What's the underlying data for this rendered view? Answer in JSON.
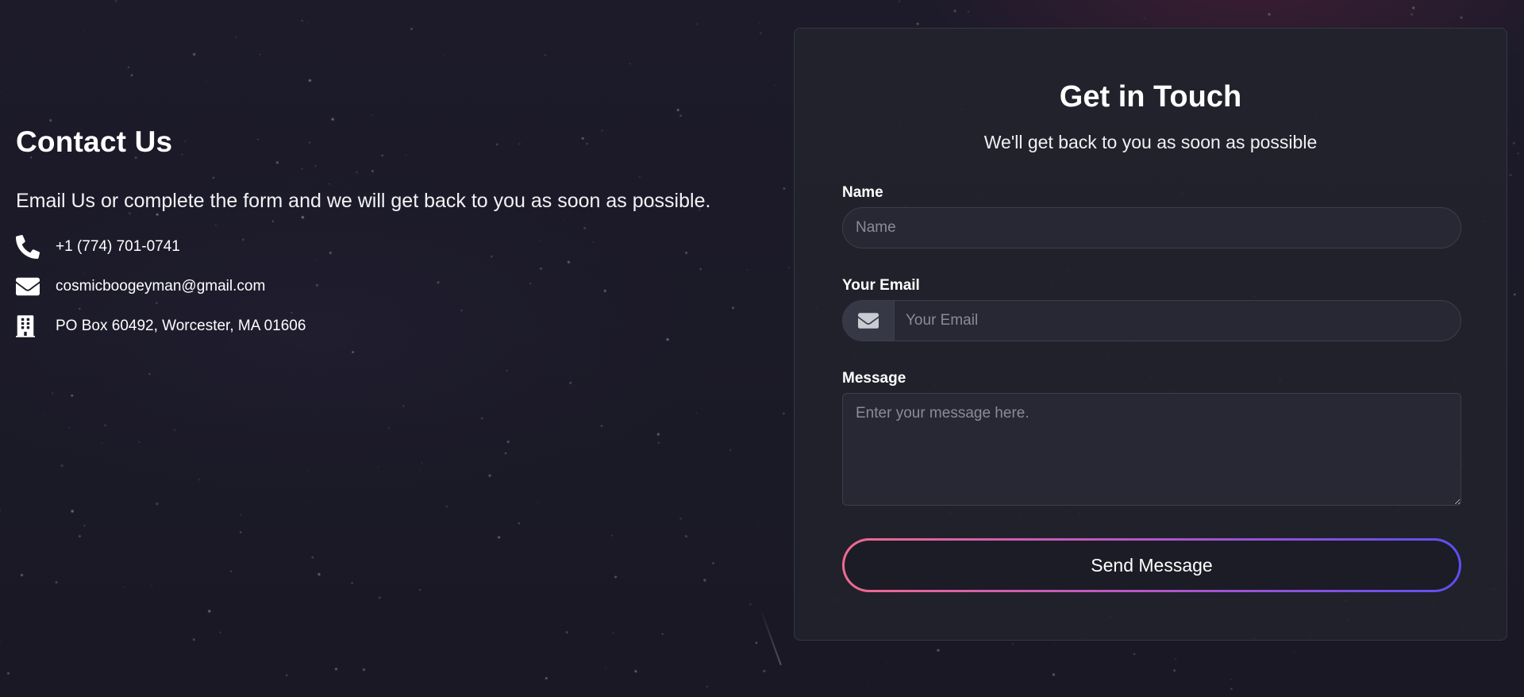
{
  "contact": {
    "title": "Contact Us",
    "intro": "Email Us or complete the form and we will get back to you as soon as possible.",
    "items": [
      {
        "icon": "phone-icon",
        "text": "+1 (774) 701-0741"
      },
      {
        "icon": "envelope-icon",
        "text": "cosmicboogeyman@gmail.com"
      },
      {
        "icon": "building-icon",
        "text": "PO Box 60492, Worcester, MA 01606"
      }
    ]
  },
  "form": {
    "title": "Get in Touch",
    "subtitle": "We'll get back to you as soon as possible",
    "name": {
      "label": "Name",
      "placeholder": "Name",
      "value": ""
    },
    "email": {
      "label": "Your Email",
      "placeholder": "Your Email",
      "value": "",
      "icon": "envelope-icon"
    },
    "message": {
      "label": "Message",
      "placeholder": "Enter your message here.",
      "value": ""
    },
    "submit_label": "Send Message"
  },
  "colors": {
    "background": "#1b1a27",
    "card": "#21222c",
    "input": "#272833",
    "button_gradient_start": "#f06a90",
    "button_gradient_end": "#5b4ff0"
  }
}
